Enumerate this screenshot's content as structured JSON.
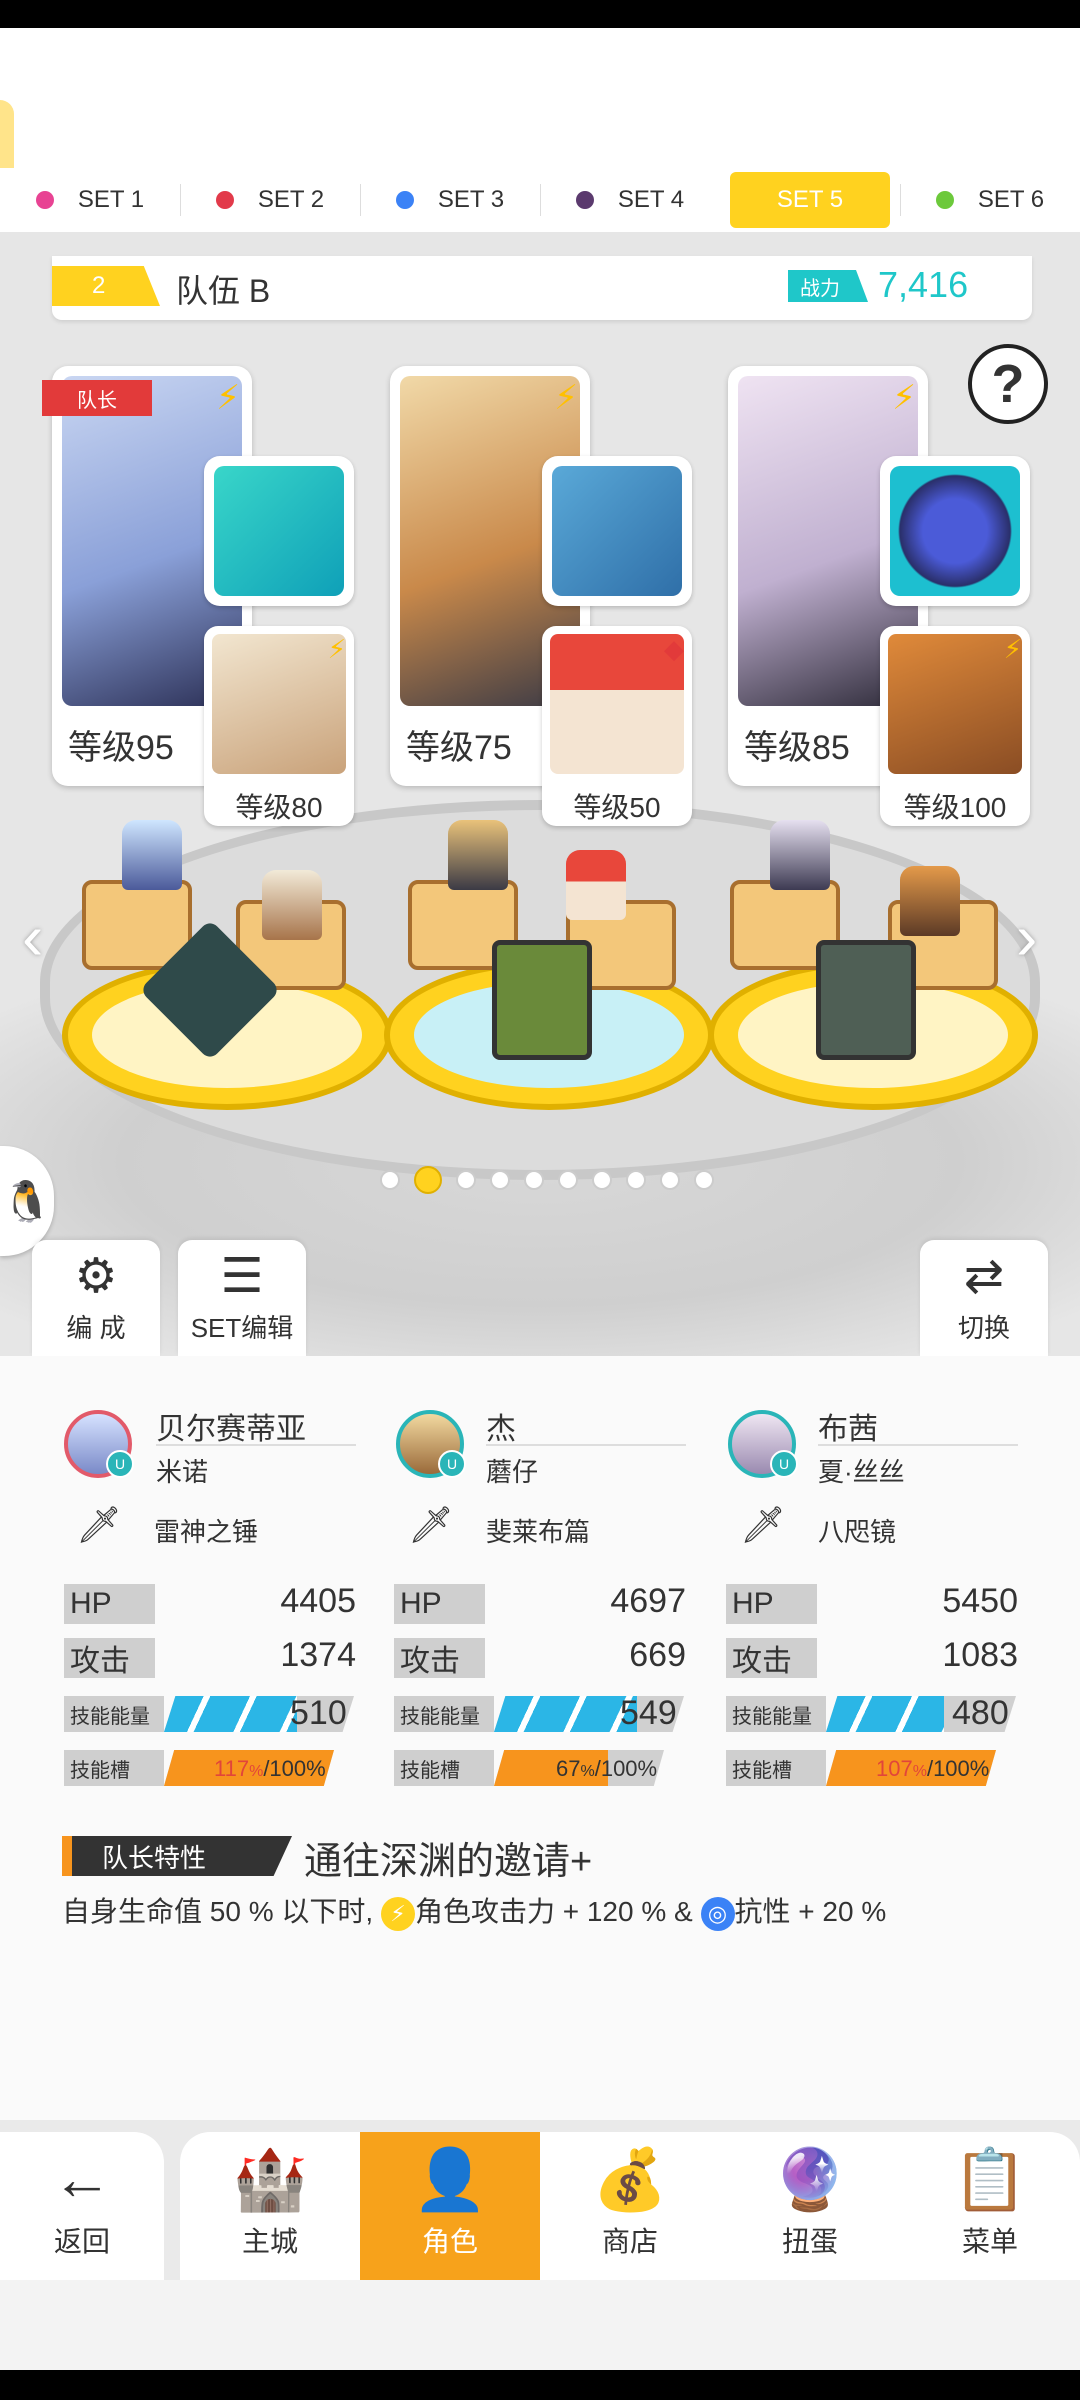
{
  "set_tabs": [
    {
      "label": "SET 1",
      "color": "#e84393",
      "active": false
    },
    {
      "label": "SET 2",
      "color": "#e23a4a",
      "active": false
    },
    {
      "label": "SET 3",
      "color": "#3b82f6",
      "active": false
    },
    {
      "label": "SET 4",
      "color": "#5b3a6e",
      "active": false
    },
    {
      "label": "SET 5",
      "color": "#ffd21f",
      "active": true
    },
    {
      "label": "SET 6",
      "color": "#6cc93b",
      "active": false
    }
  ],
  "team": {
    "number": "2",
    "name": "队伍 B",
    "power_label": "战力",
    "power_value": "7,416"
  },
  "leader_tag": "队长",
  "cards": [
    {
      "level": "等级95",
      "sub_level": "等级80",
      "sub_tag": "⚡"
    },
    {
      "level": "等级75",
      "sub_level": "等级50",
      "sub_tag": "◆"
    },
    {
      "level": "等级85",
      "sub_level": "等级100",
      "sub_tag": "⚡"
    }
  ],
  "tools": {
    "formation": "编 成",
    "set_edit": "SET编辑",
    "switch": "切换"
  },
  "members": [
    {
      "name": "贝尔赛蒂亚",
      "sub": "米诺",
      "weapon": "雷神之锤",
      "hp_label": "HP",
      "hp": "4405",
      "atk_label": "攻击",
      "atk": "1374",
      "energy_label": "技能能量",
      "energy": "510",
      "energy_fill": 0.7,
      "slot_label": "技能槽",
      "slot_cur": "117",
      "slot_unit": "%",
      "slot_max": "/100%",
      "slot_fill": 1.0,
      "slot_red": true
    },
    {
      "name": "杰",
      "sub": "蘑仔",
      "weapon": "斐莱布篇",
      "hp_label": "HP",
      "hp": "4697",
      "atk_label": "攻击",
      "atk": "669",
      "energy_label": "技能能量",
      "energy": "549",
      "energy_fill": 0.75,
      "slot_label": "技能槽",
      "slot_cur": "67",
      "slot_unit": "%",
      "slot_max": "/100%",
      "slot_fill": 0.67,
      "slot_red": false
    },
    {
      "name": "布茜",
      "sub": "夏·丝丝",
      "weapon": "八咫镜",
      "hp_label": "HP",
      "hp": "5450",
      "atk_label": "攻击",
      "atk": "1083",
      "energy_label": "技能能量",
      "energy": "480",
      "energy_fill": 0.62,
      "slot_label": "技能槽",
      "slot_cur": "107",
      "slot_unit": "%",
      "slot_max": "/100%",
      "slot_fill": 1.0,
      "slot_red": true
    }
  ],
  "leader_trait": {
    "label": "队长特性",
    "name": "通往深渊的邀请+",
    "desc_1": "自身生命值 50 % 以下时,",
    "desc_2": "角色攻击力 + 120 % &",
    "desc_3": "抗性 + 20 %"
  },
  "nav": [
    {
      "label": "返回",
      "icon": "back-arrow-icon",
      "active": false
    },
    {
      "label": "主城",
      "icon": "castle-icon",
      "active": false
    },
    {
      "label": "角色",
      "icon": "character-icon",
      "active": true
    },
    {
      "label": "商店",
      "icon": "shop-icon",
      "active": false
    },
    {
      "label": "扭蛋",
      "icon": "gacha-icon",
      "active": false
    },
    {
      "label": "菜单",
      "icon": "menu-icon",
      "active": false
    }
  ]
}
